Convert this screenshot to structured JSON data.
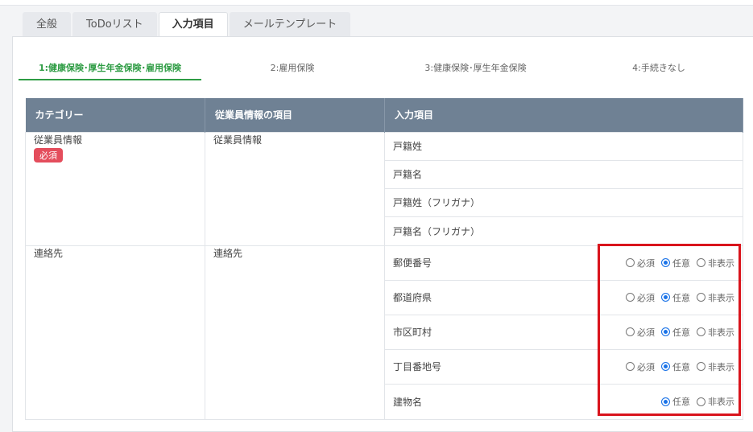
{
  "tabs": [
    "全般",
    "ToDoリスト",
    "入力項目",
    "メールテンプレート"
  ],
  "active_tab": "入力項目",
  "subtabs": [
    "1:健康保険･厚生年金保険･雇用保険",
    "2:雇用保険",
    "3:健康保険･厚生年金保険",
    "4:手続きなし"
  ],
  "table": {
    "headers": [
      "カテゴリー",
      "従業員情報の項目",
      "入力項目"
    ],
    "groups": [
      {
        "category": "従業員情報",
        "badge": "必須",
        "info": "従業員情報",
        "items": [
          {
            "label": "戸籍姓"
          },
          {
            "label": "戸籍名"
          },
          {
            "label": "戸籍姓（フリガナ）"
          },
          {
            "label": "戸籍名（フリガナ）"
          }
        ]
      },
      {
        "category": "連絡先",
        "info": "連絡先",
        "items": [
          {
            "label": "郵便番号",
            "selected": "任意"
          },
          {
            "label": "都道府県",
            "selected": "任意"
          },
          {
            "label": "市区町村",
            "selected": "任意"
          },
          {
            "label": "丁目番地号",
            "selected": "任意"
          },
          {
            "label": "建物名",
            "selected": "任意"
          }
        ]
      }
    ]
  },
  "options": {
    "required": "必須",
    "optional": "任意",
    "hidden": "非表示"
  },
  "colors": {
    "accent_green": "#2e9c44",
    "header_bg": "#6f8194",
    "badge_red": "#e44d5c",
    "highlight_red": "#d9141c",
    "radio_blue": "#1a73e8"
  }
}
